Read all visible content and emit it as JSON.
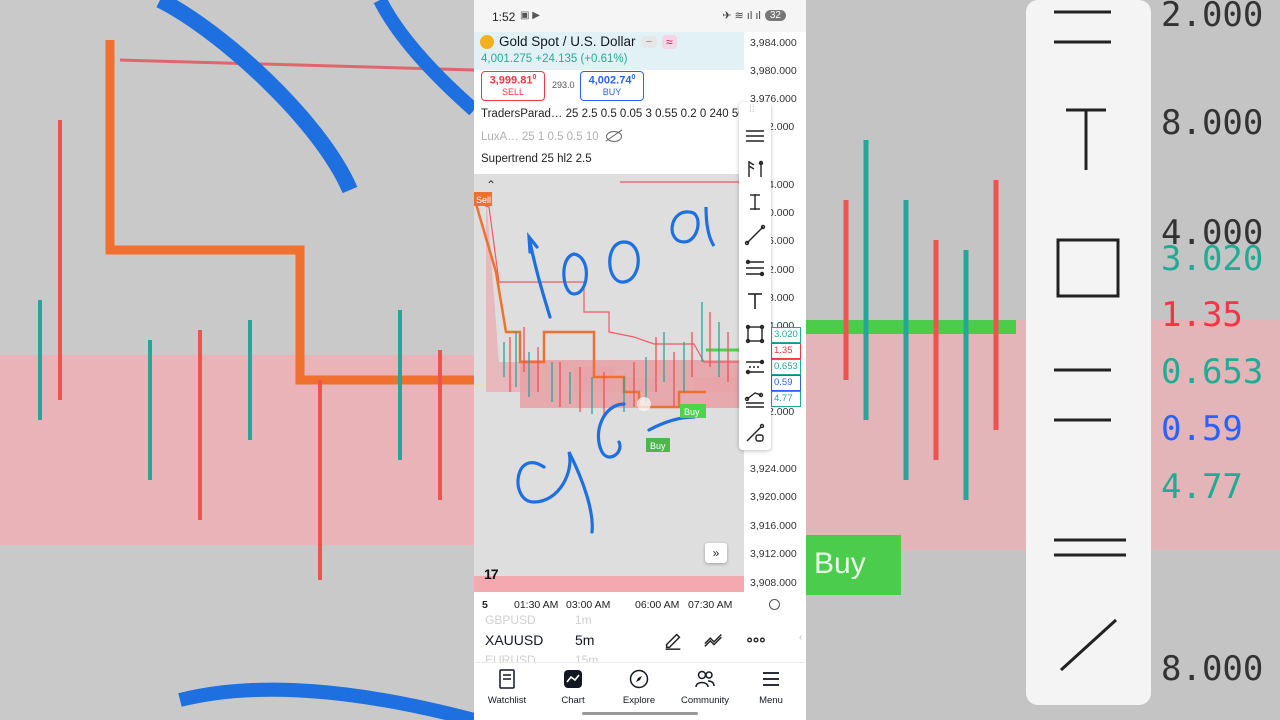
{
  "status_bar": {
    "time": "1:52",
    "notif_icons": "▣ ▶",
    "sys_icons": "✈ ≋ ıl ıl",
    "badge": "32"
  },
  "header": {
    "symbol_title": "Gold Spot / U.S. Dollar",
    "pill_minus": "−",
    "pill_wave": "≈",
    "last_price": "4,001.275",
    "change": "+24.135 (+0.61%)",
    "sell_price": "3,999.81",
    "sell_price_sup": "0",
    "sell_label": "SELL",
    "spread": "293.0",
    "buy_price": "4,002.74",
    "buy_price_sup": "0",
    "buy_label": "BUY"
  },
  "indicators": [
    {
      "text": "TradersParad…  25 2.5 0.5 0.05 3 0.55 0.2 0 240 50"
    },
    {
      "text": "LuxA…  25 1 0.5 0.5 10"
    },
    {
      "text": "Supertrend 25 hl2 2.5"
    }
  ],
  "price_axis": [
    "3,984.000",
    "3,980.000",
    "3,976.000",
    "2.000",
    "4.000",
    "0.000",
    "6.000",
    "2.000",
    "8.000",
    "4.000",
    "2.000",
    "3,924.000",
    "3,920.000",
    "3,916.000",
    "3,912.000",
    "3,908.000"
  ],
  "price_tags": [
    {
      "text": "3.020",
      "color": "#22ab94"
    },
    {
      "text": "1.35",
      "color": "#f23645"
    },
    {
      "text": "0.653",
      "color": "#22ab94"
    },
    {
      "text": "0.59",
      "color": "#2962ff"
    },
    {
      "text": "4.77",
      "color": "#22ab94"
    }
  ],
  "signals": {
    "sell": "Sell",
    "buy1": "Buy",
    "buy2": "Buy"
  },
  "handwriting": {
    "top": "1000",
    "bottom": "96"
  },
  "time_axis": {
    "tf": "5",
    "t1": "01:30 AM",
    "t2": "03:00 AM",
    "t3": "06:00 AM",
    "t4": "07:30 AM"
  },
  "symbol_bar": {
    "ghost_above": "GBPUSD",
    "ghost_above_tf": "1m",
    "symbol": "XAUUSD",
    "timeframe": "5m",
    "ghost_below": "EURUSD",
    "ghost_below_tf": "15m"
  },
  "nav": [
    {
      "label": "Watchlist",
      "icon": "watchlist-icon"
    },
    {
      "label": "Chart",
      "icon": "chart-icon"
    },
    {
      "label": "Explore",
      "icon": "compass-icon"
    },
    {
      "label": "Community",
      "icon": "people-icon"
    },
    {
      "label": "Menu",
      "icon": "menu-icon"
    }
  ],
  "colors": {
    "up": "#22ab94",
    "down": "#f23645",
    "accent": "#2962ff",
    "ink": "#1e6fe0",
    "supertrend": "#f07030"
  },
  "tv_logo": "17"
}
